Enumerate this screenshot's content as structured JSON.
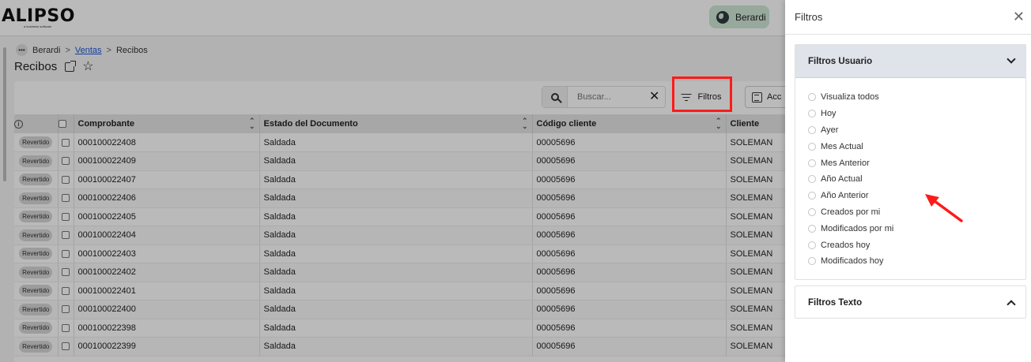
{
  "header": {
    "logo": "ALIPSO",
    "logo_tagline": "a business software",
    "user_button": "Berardi",
    "user_icon": "globe-icon"
  },
  "breadcrumb": {
    "root": "Berardi",
    "link": "Ventas",
    "current": "Recibos",
    "separator": ">"
  },
  "page": {
    "title": "Recibos"
  },
  "toolbar": {
    "search_placeholder": "Buscar...",
    "filtros_label": "Filtros",
    "acciones_label": "Acc"
  },
  "table": {
    "columns": [
      "Comprobante",
      "Estado del Documento",
      "Código cliente",
      "Cliente"
    ],
    "rows": [
      {
        "badge": "Revertido",
        "comprobante": "000100022408",
        "estado": "Saldada",
        "codigo": "00005696",
        "cliente": "SOLEMAN"
      },
      {
        "badge": "Revertido",
        "comprobante": "000100022409",
        "estado": "Saldada",
        "codigo": "00005696",
        "cliente": "SOLEMAN"
      },
      {
        "badge": "Revertido",
        "comprobante": "000100022407",
        "estado": "Saldada",
        "codigo": "00005696",
        "cliente": "SOLEMAN"
      },
      {
        "badge": "Revertido",
        "comprobante": "000100022406",
        "estado": "Saldada",
        "codigo": "00005696",
        "cliente": "SOLEMAN"
      },
      {
        "badge": "Revertido",
        "comprobante": "000100022405",
        "estado": "Saldada",
        "codigo": "00005696",
        "cliente": "SOLEMAN"
      },
      {
        "badge": "Revertido",
        "comprobante": "000100022404",
        "estado": "Saldada",
        "codigo": "00005696",
        "cliente": "SOLEMAN"
      },
      {
        "badge": "Revertido",
        "comprobante": "000100022403",
        "estado": "Saldada",
        "codigo": "00005696",
        "cliente": "SOLEMAN"
      },
      {
        "badge": "Revertido",
        "comprobante": "000100022402",
        "estado": "Saldada",
        "codigo": "00005696",
        "cliente": "SOLEMAN"
      },
      {
        "badge": "Revertido",
        "comprobante": "000100022401",
        "estado": "Saldada",
        "codigo": "00005696",
        "cliente": "SOLEMAN"
      },
      {
        "badge": "Revertido",
        "comprobante": "000100022400",
        "estado": "Saldada",
        "codigo": "00005696",
        "cliente": "SOLEMAN"
      },
      {
        "badge": "Revertido",
        "comprobante": "000100022398",
        "estado": "Saldada",
        "codigo": "00005696",
        "cliente": "SOLEMAN"
      },
      {
        "badge": "Revertido",
        "comprobante": "000100022399",
        "estado": "Saldada",
        "codigo": "00005696",
        "cliente": "SOLEMAN"
      }
    ]
  },
  "panel": {
    "title": "Filtros",
    "sections": {
      "usuario": {
        "title": "Filtros Usuario",
        "options": [
          "Visualiza todos",
          "Hoy",
          "Ayer",
          "Mes Actual",
          "Mes Anterior",
          "Año Actual",
          "Año Anterior",
          "Creados por mi",
          "Modificados por mi",
          "Creados hoy",
          "Modificados hoy"
        ]
      },
      "texto": {
        "title": "Filtros Texto"
      }
    }
  },
  "colors": {
    "highlight": "#ff1a1a",
    "user_button_bg": "#cfe6d6",
    "section_header_bg": "#dfe3ea",
    "link": "#1a56db"
  }
}
